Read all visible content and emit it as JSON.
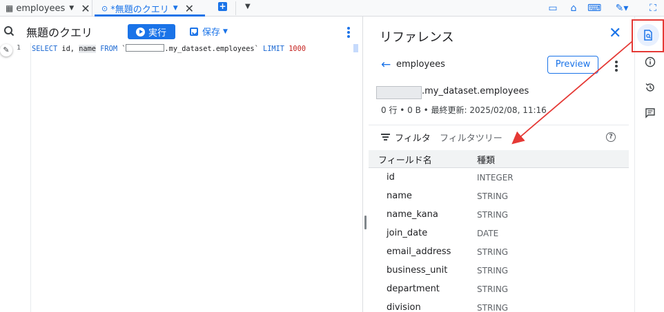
{
  "tabs": [
    {
      "label": "employees",
      "icon": "table-icon"
    },
    {
      "label": "*無題のクエリ",
      "icon": "query-icon"
    }
  ],
  "editor": {
    "title": "無題のクエリ",
    "run_label": "実行",
    "save_label": "保存",
    "line_number": "1",
    "code": {
      "select": "SELECT",
      "cols_a": " id, ",
      "col_name": "name",
      "from": " FROM ",
      "tick_open": "`",
      "path": ".my_dataset.employees",
      "tick_close": "`",
      "limit": " LIMIT ",
      "limit_value": "1000"
    }
  },
  "reference": {
    "title": "リファレンス",
    "table_name": "employees",
    "preview_label": "Preview",
    "table_path": ".my_dataset.employees",
    "meta": "0 行 • 0 B • 最終更新: 2025/02/08, 11:16",
    "filter_label": "フィルタ",
    "filter_placeholder": "フィルタツリー",
    "col_field": "フィールド名",
    "col_type": "種類",
    "fields": [
      {
        "name": "id",
        "type": "INTEGER"
      },
      {
        "name": "name",
        "type": "STRING"
      },
      {
        "name": "name_kana",
        "type": "STRING"
      },
      {
        "name": "join_date",
        "type": "DATE"
      },
      {
        "name": "email_address",
        "type": "STRING"
      },
      {
        "name": "business_unit",
        "type": "STRING"
      },
      {
        "name": "department",
        "type": "STRING"
      },
      {
        "name": "division",
        "type": "STRING"
      }
    ]
  },
  "colors": {
    "accent": "#1a73e8",
    "annotation": "#e53935"
  }
}
